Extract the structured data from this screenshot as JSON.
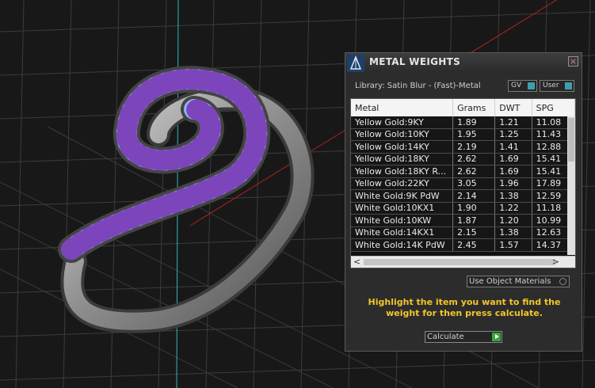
{
  "panel": {
    "title": "METAL WEIGHTS",
    "close_glyph": "×",
    "library_label": "Library: Satin Blur - (Fast)-Metal",
    "gv_label": "GV",
    "user_label": "User",
    "columns": [
      "Metal",
      "Grams",
      "DWT",
      "SPG"
    ],
    "rows": [
      {
        "metal": "Yellow Gold:9KY",
        "grams": "1.89",
        "dwt": "1.21",
        "spg": "11.08"
      },
      {
        "metal": "Yellow Gold:10KY",
        "grams": "1.95",
        "dwt": "1.25",
        "spg": "11.43"
      },
      {
        "metal": "Yellow Gold:14KY",
        "grams": "2.19",
        "dwt": "1.41",
        "spg": "12.88"
      },
      {
        "metal": "Yellow Gold:18KY",
        "grams": "2.62",
        "dwt": "1.69",
        "spg": "15.41"
      },
      {
        "metal": "Yellow Gold:18KY R...",
        "grams": "2.62",
        "dwt": "1.69",
        "spg": "15.41"
      },
      {
        "metal": "Yellow Gold:22KY",
        "grams": "3.05",
        "dwt": "1.96",
        "spg": "17.89"
      },
      {
        "metal": "White Gold:9K PdW",
        "grams": "2.14",
        "dwt": "1.38",
        "spg": "12.59"
      },
      {
        "metal": "White Gold:10KX1",
        "grams": "1.90",
        "dwt": "1.22",
        "spg": "11.18"
      },
      {
        "metal": "White Gold:10KW",
        "grams": "1.87",
        "dwt": "1.20",
        "spg": "10.99"
      },
      {
        "metal": "White Gold:14KX1",
        "grams": "2.15",
        "dwt": "1.38",
        "spg": "12.63"
      },
      {
        "metal": "White Gold:14K PdW",
        "grams": "2.45",
        "dwt": "1.57",
        "spg": "14.37"
      }
    ],
    "scroll_left": "<",
    "scroll_right": ">",
    "use_object_materials": "Use Object Materials",
    "hint": "Highlight the item you want to find the weight for then press calculate.",
    "calculate_label": "Calculate"
  },
  "colors": {
    "hint": "#f2c62a",
    "toggle_accent": "#3c9fae",
    "calculate_go": "#3aa63a",
    "stones": "#7b39b5",
    "stone_pave": "#8ab4f0"
  }
}
